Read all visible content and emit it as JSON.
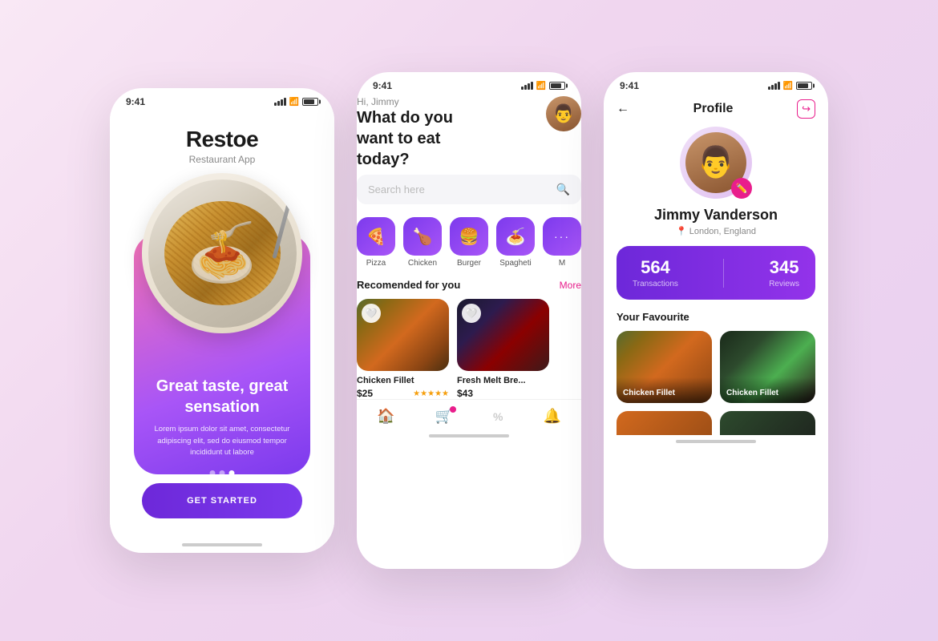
{
  "app": {
    "name": "Restoe",
    "subtitle": "Restaurant App",
    "status_time": "9:41"
  },
  "phone1": {
    "headline": "Great taste, great sensation",
    "body_text": "Lorem ipsum dolor sit amet, consectetur adipiscing elit, sed do eiusmod tempor incididunt ut labore",
    "cta_label": "GET STARTED",
    "dots": [
      "",
      "",
      ""
    ],
    "active_dot": 2
  },
  "phone2": {
    "greeting_hi": "Hi, Jimmy",
    "greeting_question": "What do you want to eat today?",
    "search_placeholder": "Search here",
    "categories": [
      {
        "label": "Pizza",
        "icon": "🍕"
      },
      {
        "label": "Chicken",
        "icon": "🍗"
      },
      {
        "label": "Burger",
        "icon": "🍔"
      },
      {
        "label": "Spagheti",
        "icon": "🍝"
      },
      {
        "label": "More",
        "icon": "•••"
      }
    ],
    "section_title": "Recomended for you",
    "section_more": "More",
    "foods": [
      {
        "name": "Chicken Fillet",
        "price": "$25",
        "rating": "★★★★★"
      },
      {
        "name": "Fresh Melt Bre...",
        "price": "$43",
        "rating": ""
      }
    ],
    "nav_items": [
      "🏠",
      "🛒",
      "%",
      "🔔"
    ]
  },
  "phone3": {
    "back_label": "←",
    "title": "Profile",
    "logout_icon": "logout",
    "user_name": "Jimmy Vanderson",
    "user_location": "London, England",
    "stats": [
      {
        "number": "564",
        "label": "Transactions"
      },
      {
        "number": "345",
        "label": "Reviews"
      }
    ],
    "favourites_title": "Your Favourite",
    "favourites": [
      {
        "name": "Chicken Fillet"
      },
      {
        "name": "Chicken Fillet"
      },
      {
        "name": "",
        "partial": true
      },
      {
        "name": "",
        "partial": true
      }
    ]
  }
}
